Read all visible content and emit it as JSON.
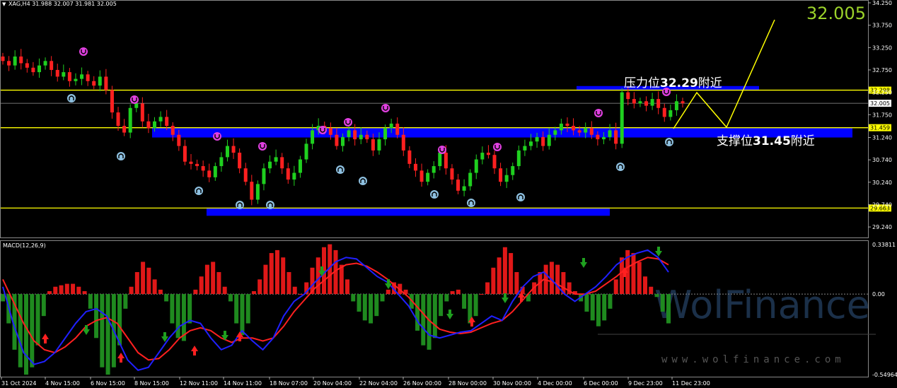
{
  "chart_data": [
    {
      "type": "candlestick",
      "symbol_header": "XAG,H4  31.988 32.007 31.981 32.005",
      "last_price": "32.005",
      "y_ticks": [
        "34.250",
        "33.750",
        "33.250",
        "32.750",
        "32.250",
        "31.750",
        "31.240",
        "30.740",
        "30.240",
        "29.740",
        "29.240"
      ],
      "ylim": [
        29.1,
        34.25
      ],
      "x_ticks": [
        "31 Oct 2024",
        "4 Nov 15:00",
        "6 Nov 15:00",
        "8 Nov 15:00",
        "12 Nov 11:00",
        "14 Nov 11:00",
        "18 Nov 07:00",
        "20 Nov 04:00",
        "22 Nov 04:00",
        "26 Nov 00:00",
        "28 Nov 00:00",
        "30 Nov 00:00",
        "4 Dec 00:00",
        "6 Dec 00:00",
        "9 Dec 23:00",
        "11 Dec 23:00"
      ],
      "close_series": [
        32.95,
        32.85,
        33.05,
        32.9,
        32.8,
        32.7,
        32.85,
        32.95,
        32.75,
        32.6,
        32.7,
        32.5,
        32.55,
        32.65,
        32.5,
        32.4,
        32.6,
        32.3,
        31.8,
        31.5,
        31.35,
        31.9,
        32.0,
        31.6,
        31.45,
        31.6,
        31.7,
        31.5,
        31.3,
        31.05,
        30.7,
        30.65,
        30.6,
        30.5,
        30.35,
        30.6,
        30.8,
        31.05,
        30.9,
        30.55,
        30.25,
        29.85,
        30.2,
        30.55,
        30.7,
        30.8,
        30.55,
        30.3,
        30.45,
        30.75,
        31.1,
        31.4,
        31.5,
        31.45,
        31.3,
        31.05,
        31.25,
        31.4,
        31.2,
        31.3,
        31.2,
        30.95,
        31.2,
        31.45,
        31.55,
        31.3,
        30.95,
        30.65,
        30.5,
        30.25,
        30.45,
        30.6,
        30.9,
        30.55,
        30.3,
        30.05,
        30.15,
        30.45,
        30.75,
        30.9,
        30.85,
        30.55,
        30.25,
        30.4,
        30.6,
        30.95,
        31.05,
        31.15,
        31.25,
        31.05,
        31.3,
        31.4,
        31.55,
        31.5,
        31.4,
        31.35,
        31.45,
        31.3,
        31.2,
        31.25,
        31.4,
        31.1,
        32.25,
        32.1,
        32.0,
        32.05,
        31.95,
        32.1,
        31.9,
        31.7,
        31.85,
        32.05,
        32.005
      ],
      "lines": [
        {
          "label": "32.298",
          "value": 32.298,
          "color": "#ffff00"
        },
        {
          "label": "32.005",
          "value": 32.005,
          "color": "#999999"
        },
        {
          "label": "31.459",
          "value": 31.459,
          "color": "#ffff00"
        },
        {
          "label": "29.663",
          "value": 29.663,
          "color": "#ffff00"
        }
      ],
      "resistance_text": {
        "prefix": "压力位",
        "value": "32.29",
        "suffix": "附近"
      },
      "support_text": {
        "prefix": "支撑位",
        "value": "31.45",
        "suffix": "附近"
      },
      "colors": {
        "bull": "#1fd01f",
        "bear": "#ff2020",
        "zone": "#0000ff",
        "level": "#ffff00",
        "arrow_up": "#8ec0e0",
        "arrow_down": "#e040e0"
      }
    },
    {
      "type": "macd",
      "title": "MACD(12,26,9)",
      "y_ticks": [
        "0.33811",
        "0.00",
        "-0.54964"
      ],
      "ylim": [
        -0.54964,
        0.33811
      ],
      "histogram": [
        -0.05,
        -0.2,
        -0.38,
        -0.5,
        -0.55,
        -0.5,
        -0.35,
        -0.15,
        0.02,
        0.05,
        0.06,
        0.07,
        0.07,
        0.05,
        0.02,
        -0.1,
        -0.3,
        -0.5,
        -0.55,
        -0.5,
        -0.35,
        -0.1,
        0.05,
        0.15,
        0.22,
        0.18,
        0.1,
        0.03,
        -0.05,
        -0.2,
        -0.3,
        -0.32,
        -0.2,
        0.03,
        0.12,
        0.2,
        0.22,
        0.15,
        0.05,
        -0.05,
        -0.2,
        -0.28,
        -0.2,
        0.02,
        0.1,
        0.2,
        0.28,
        0.3,
        0.25,
        0.15,
        0.05,
        0.0,
        0.08,
        0.18,
        0.25,
        0.32,
        0.34,
        0.3,
        0.2,
        0.1,
        -0.05,
        -0.12,
        -0.18,
        -0.2,
        -0.15,
        -0.05,
        0.03,
        0.08,
        0.07,
        0.03,
        -0.1,
        -0.25,
        -0.35,
        -0.38,
        -0.3,
        -0.15,
        -0.05,
        0.02,
        0.03,
        -0.1,
        -0.2,
        -0.15,
        0.0,
        0.08,
        0.18,
        0.25,
        0.32,
        0.28,
        0.15,
        0.05,
        -0.05,
        0.08,
        0.15,
        0.2,
        0.22,
        0.2,
        0.15,
        0.08,
        0.02,
        -0.05,
        -0.12,
        -0.18,
        -0.22,
        -0.18,
        -0.1,
        0.1,
        0.25,
        0.3,
        0.28,
        0.22,
        0.12,
        0.05,
        -0.02,
        -0.12,
        -0.2
      ],
      "macd_line": [
        0.05,
        -0.2,
        -0.4,
        -0.48,
        -0.46,
        -0.4,
        -0.3,
        -0.2,
        -0.12,
        -0.1,
        -0.15,
        -0.3,
        -0.45,
        -0.52,
        -0.5,
        -0.4,
        -0.3,
        -0.22,
        -0.18,
        -0.2,
        -0.3,
        -0.38,
        -0.35,
        -0.25,
        -0.32,
        -0.38,
        -0.3,
        -0.15,
        -0.05,
        0.0,
        0.08,
        0.15,
        0.22,
        0.25,
        0.24,
        0.18,
        0.12,
        0.08,
        0.0,
        -0.08,
        -0.2,
        -0.28,
        -0.3,
        -0.28,
        -0.26,
        -0.25,
        -0.2,
        -0.15,
        -0.18,
        -0.05,
        0.05,
        0.12,
        0.15,
        0.08,
        0.0,
        -0.05,
        0.0,
        0.05,
        0.12,
        0.2,
        0.25,
        0.28,
        0.3,
        0.25,
        0.15
      ],
      "signal_line": [
        0.1,
        -0.05,
        -0.2,
        -0.32,
        -0.38,
        -0.4,
        -0.36,
        -0.3,
        -0.22,
        -0.18,
        -0.16,
        -0.2,
        -0.3,
        -0.4,
        -0.45,
        -0.44,
        -0.38,
        -0.3,
        -0.25,
        -0.23,
        -0.25,
        -0.3,
        -0.33,
        -0.3,
        -0.3,
        -0.32,
        -0.3,
        -0.22,
        -0.12,
        -0.04,
        0.04,
        0.1,
        0.16,
        0.2,
        0.21,
        0.19,
        0.15,
        0.1,
        0.04,
        -0.02,
        -0.1,
        -0.18,
        -0.24,
        -0.26,
        -0.27,
        -0.26,
        -0.23,
        -0.2,
        -0.18,
        -0.12,
        -0.04,
        0.04,
        0.1,
        0.08,
        0.04,
        0.0,
        0.0,
        0.02,
        0.07,
        0.12,
        0.18,
        0.22,
        0.25,
        0.24,
        0.2
      ]
    }
  ],
  "watermark": {
    "brand": "WolFinance",
    "url": "www.wolfinance.com"
  }
}
